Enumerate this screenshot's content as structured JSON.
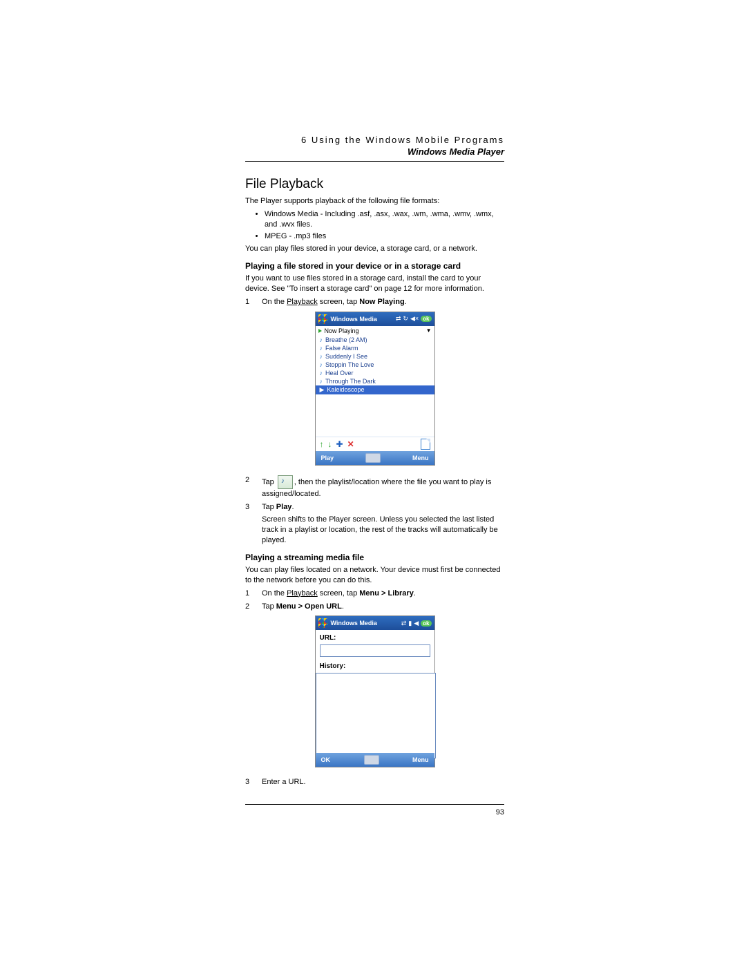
{
  "header": {
    "chapter": "6 Using the Windows Mobile Programs",
    "section": "Windows Media Player"
  },
  "h2": "File Playback",
  "intro": "The Player supports playback of the following file formats:",
  "formats": [
    "Windows Media - Including .asf, .asx, .wax, .wm, .wma, .wmv, .wmx, and .wvx files.",
    "MPEG - .mp3 files"
  ],
  "intro2": "You can play files stored in your device, a storage card, or a network.",
  "section1": {
    "title": "Playing a file stored in your device or in a storage card",
    "lead": "If you want to use files stored in a storage card, install the card to your device. See \"To insert a storage card\" on page 12 for more information.",
    "step1_pre": "On the ",
    "step1_link": "Playback",
    "step1_mid": " screen, tap ",
    "step1_bold": "Now Playing",
    "step1_post": ".",
    "step2_pre": "Tap ",
    "step2_post": ", then the playlist/location where the file you want to play is assigned/located.",
    "step3_pre": "Tap ",
    "step3_bold": "Play",
    "step3_post": ".",
    "step3_note": "Screen shifts to the Player screen. Unless you selected the last listed track in a playlist or location, the rest of the tracks will automatically be played."
  },
  "screenshot1": {
    "title": "Windows Media",
    "ok": "ok",
    "now_playing": "Now Playing",
    "tracks": [
      "Breathe (2 AM)",
      "False Alarm",
      "Suddenly I See",
      "Stoppin The Love",
      "Heal Over",
      "Through The Dark",
      "Kaleidoscope"
    ],
    "selected_index": 6,
    "bottom_left": "Play",
    "bottom_right": "Menu"
  },
  "section2": {
    "title": "Playing a streaming media file",
    "lead": "You can play files located on a network. Your device must first be connected to the network before you can do this.",
    "step1_pre": "On the ",
    "step1_link": "Playback",
    "step1_mid": " screen, tap ",
    "step1_bold": "Menu > Library",
    "step1_post": ".",
    "step2_pre": "Tap ",
    "step2_bold": "Menu > Open URL",
    "step2_post": ".",
    "step3": "Enter a URL."
  },
  "screenshot2": {
    "title": "Windows Media",
    "ok": "ok",
    "url_label": "URL:",
    "history_label": "History:",
    "bottom_left": "OK",
    "bottom_right": "Menu"
  },
  "page_number": "93"
}
